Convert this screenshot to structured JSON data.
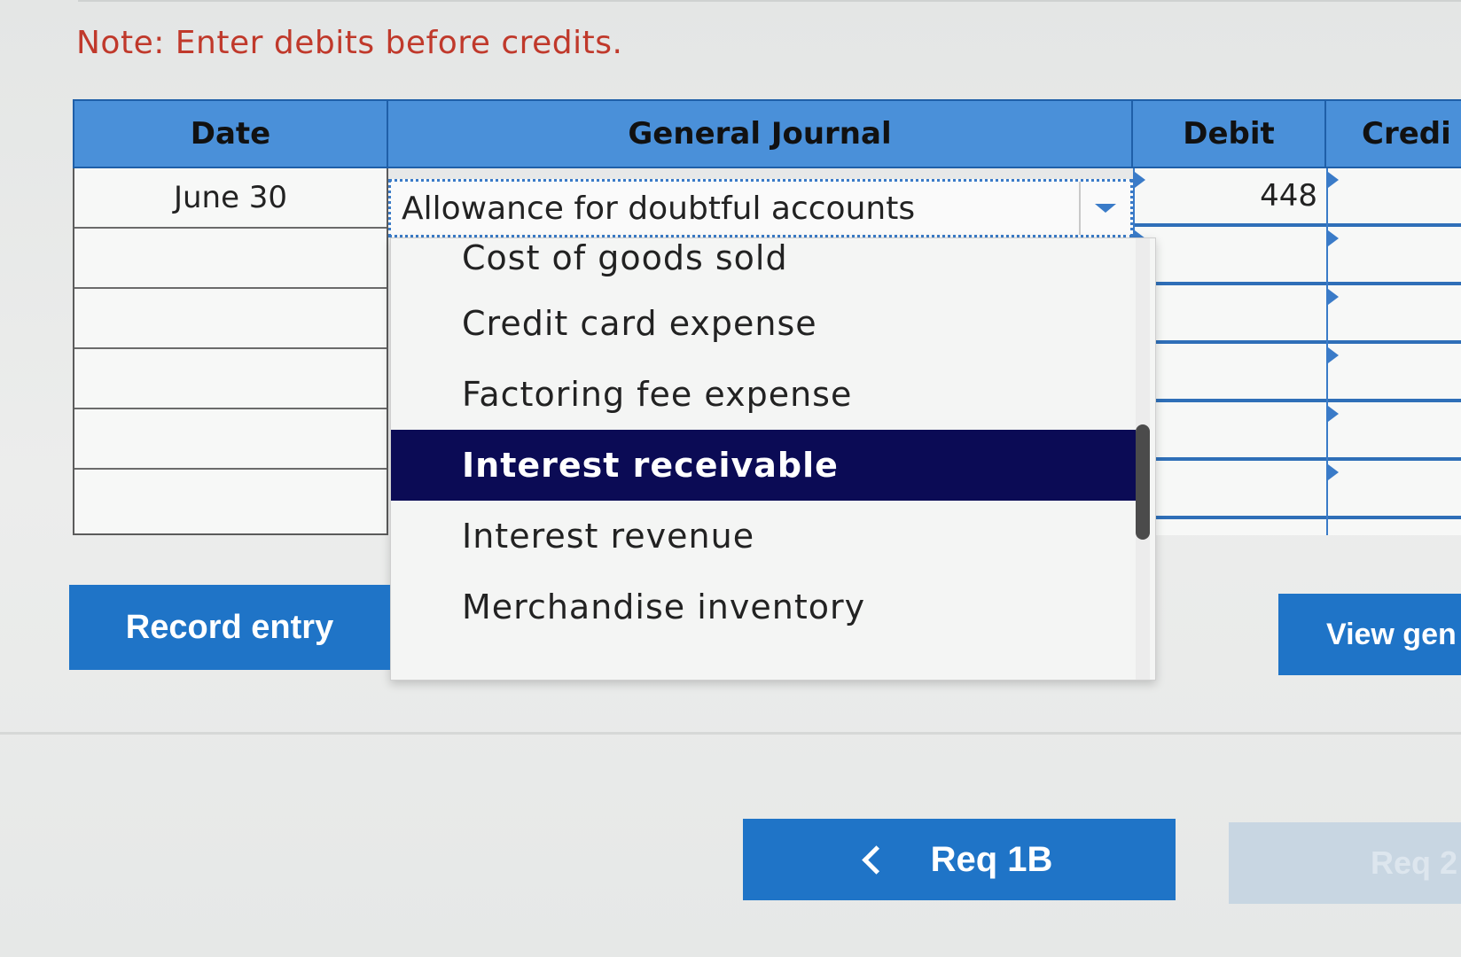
{
  "note": "Note: Enter debits before credits.",
  "table": {
    "headers": {
      "date": "Date",
      "general_journal": "General Journal",
      "debit": "Debit",
      "credit": "Credi"
    },
    "rows": [
      {
        "date": "June 30",
        "account": "Allowance for doubtful accounts",
        "debit": "448",
        "credit": ""
      },
      {
        "date": "",
        "account": "",
        "debit": "",
        "credit": ""
      },
      {
        "date": "",
        "account": "",
        "debit": "",
        "credit": ""
      },
      {
        "date": "",
        "account": "",
        "debit": "",
        "credit": ""
      },
      {
        "date": "",
        "account": "",
        "debit": "",
        "credit": ""
      },
      {
        "date": "",
        "account": "",
        "debit": "",
        "credit": ""
      }
    ]
  },
  "dropdown": {
    "options": [
      "Cost of goods sold",
      "Credit card expense",
      "Factoring fee expense",
      "Interest receivable",
      "Interest revenue",
      "Merchandise inventory"
    ],
    "highlighted": "Interest receivable"
  },
  "buttons": {
    "record_entry": "Record entry",
    "view_general": "View gen",
    "req_prev": "Req 1B",
    "req_next": "Req 2"
  },
  "icons": {
    "dropdown": "chevron-down-icon",
    "prev": "chevron-left-icon"
  },
  "colors": {
    "header_blue": "#4a90d9",
    "button_blue": "#1f74c7",
    "highlight_navy": "#0b0b55",
    "note_red": "#c0392b"
  }
}
